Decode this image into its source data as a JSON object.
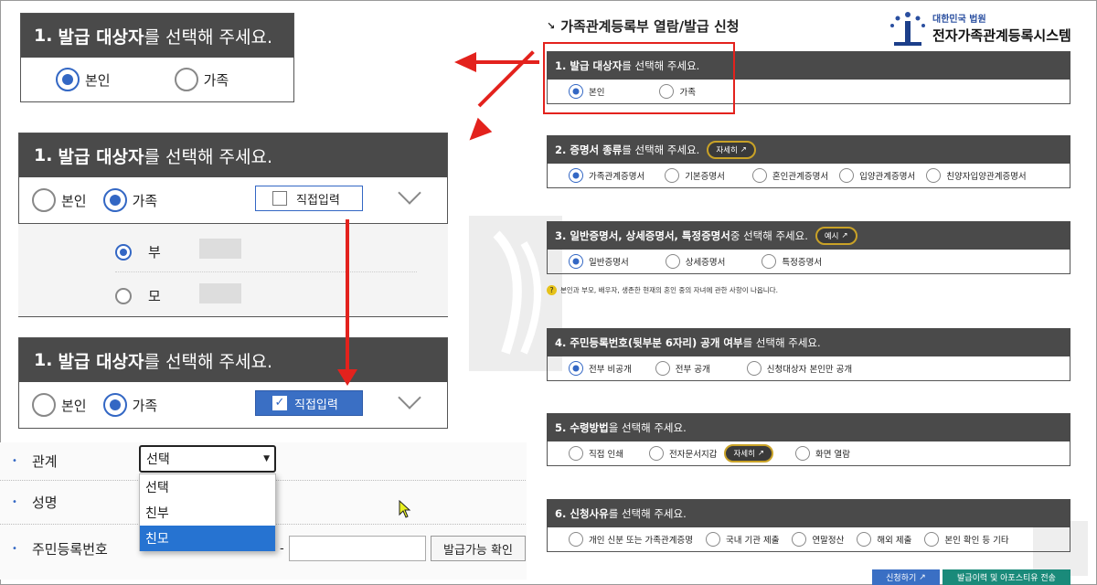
{
  "zoom_panels": {
    "p1": {
      "num": "1.",
      "title_bold": "발급 대상자",
      "title_rest": "를 선택해 주세요.",
      "options": [
        "본인",
        "가족"
      ]
    },
    "p2": {
      "num": "1.",
      "title_bold": "발급 대상자",
      "title_rest": "를 선택해 주세요.",
      "options": [
        "본인",
        "가족"
      ],
      "direct_label": "직접입력",
      "family": [
        "부",
        "모"
      ]
    },
    "p3": {
      "num": "1.",
      "title_bold": "발급 대상자",
      "title_rest": "를 선택해 주세요.",
      "options": [
        "본인",
        "가족"
      ],
      "direct_label": "직접입력"
    }
  },
  "form": {
    "rows": [
      "관계",
      "성명",
      "주민등록번호"
    ],
    "select_value": "선택",
    "dropdown_options": [
      "선택",
      "친부",
      "친모"
    ],
    "dash": "-",
    "check_button": "발급가능 확인"
  },
  "header": {
    "title": "가족관계등록부 열람/발급 신청",
    "logo_sub": "대한민국 법원",
    "logo_main": "전자가족관계등록시스템"
  },
  "sections": [
    {
      "title_html_a": "1. 발급 대상자",
      "title_rest": "를 선택해 주세요.",
      "options": [
        "본인",
        "가족"
      ],
      "selected": 0
    },
    {
      "title_html_a": "2. 증명서 종류",
      "title_rest": "를 선택해 주세요.",
      "pill": "자세히",
      "options": [
        "가족관계증명서",
        "기본증명서",
        "혼인관계증명서",
        "입양관계증명서",
        "친양자입양관계증명서"
      ],
      "selected": 0
    },
    {
      "title_html_a": "3. 일반증명서, 상세증명서, 특정증명서",
      "title_rest": " 중 선택해 주세요.",
      "pill": "예시",
      "options": [
        "일반증명서",
        "상세증명서",
        "특정증명서"
      ],
      "selected": 0,
      "note": "본인과 부모, 배우자, 생존한 현재의 혼인 중의 자녀에 관한 사항이 나옵니다."
    },
    {
      "title_html_a": "4. 주민등록번호(뒷부분 6자리) 공개 여부",
      "title_rest": "를 선택해 주세요.",
      "options": [
        "전부 비공개",
        "전부 공개",
        "신청대상자 본인만 공개"
      ],
      "selected": 0
    },
    {
      "title_html_a": "5. 수령방법",
      "title_rest": "을 선택해 주세요.",
      "options": [
        "직접 인쇄",
        "전자문서지갑",
        "화면 열람"
      ],
      "pill_after": "자세히",
      "selected": -1
    },
    {
      "title_html_a": "6. 신청사유",
      "title_rest": "를 선택해 주세요.",
      "options": [
        "개인 신분 또는 가족관계증명",
        "국내 기관 제출",
        "연말정산",
        "해외 제출",
        "본인 확인 등 기타"
      ],
      "selected": -1
    }
  ],
  "bottom_buttons": [
    "신청하기",
    "발급이력 및 아포스티유 전송"
  ],
  "colors": {
    "accent": "#3367c4",
    "header": "#4a4a4a",
    "arrow": "#e3221d",
    "highlight": "#e3221d",
    "button_blue": "#3a6fc4",
    "button_teal": "#1a8a7a"
  }
}
